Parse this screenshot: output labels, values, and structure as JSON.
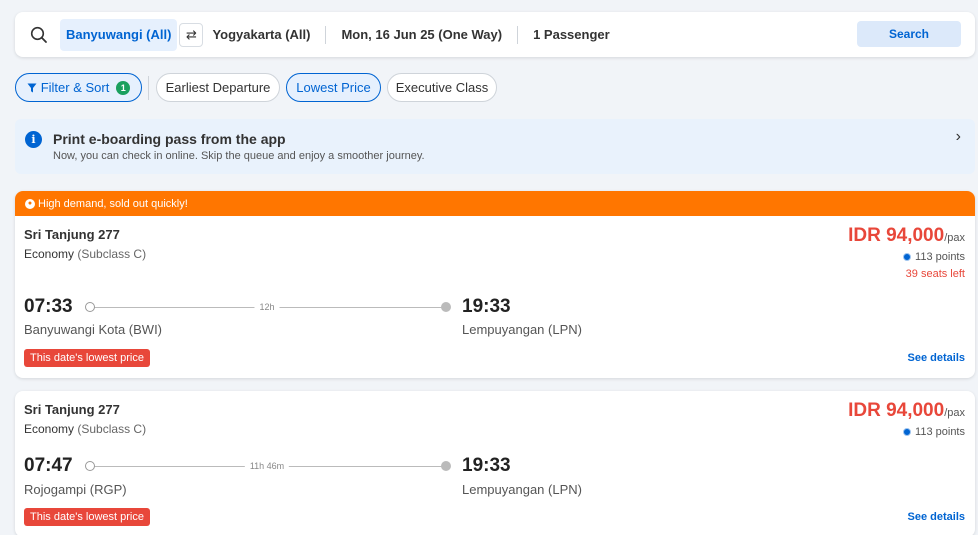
{
  "search": {
    "origin": "Banyuwangi (All)",
    "destination": "Yogyakarta (All)",
    "date": "Mon, 16 Jun 25 (One Way)",
    "passengers": "1 Passenger",
    "button": "Search"
  },
  "filters": {
    "filter_sort": "Filter & Sort",
    "filter_count": "1",
    "chips": [
      "Earliest Departure",
      "Lowest Price",
      "Executive Class"
    ],
    "active_chip": "Lowest Price"
  },
  "banner": {
    "title": "Print e-boarding pass from the app",
    "subtitle": "Now, you can check in online. Skip the queue and enjoy a smoother journey.",
    "info_icon": "i",
    "chevron": "›"
  },
  "results": [
    {
      "demand": "High demand, sold out quickly!",
      "name": "Sri Tanjung 277",
      "class": "Economy",
      "subclass": "(Subclass C)",
      "price": "IDR 94,000",
      "per": "/pax",
      "points": "113 points",
      "seats": "39 seats left",
      "dep_time": "07:33",
      "dep_station": "Banyuwangi Kota (BWI)",
      "duration": "12h",
      "arr_time": "19:33",
      "arr_station": "Lempuyangan (LPN)",
      "badge": "This date's lowest price",
      "details": "See details"
    },
    {
      "name": "Sri Tanjung 277",
      "class": "Economy",
      "subclass": "(Subclass C)",
      "price": "IDR 94,000",
      "per": "/pax",
      "points": "113 points",
      "dep_time": "07:47",
      "dep_station": "Rojogampi (RGP)",
      "duration": "11h 46m",
      "arr_time": "19:33",
      "arr_station": "Lempuyangan (LPN)",
      "badge": "This date's lowest price",
      "details": "See details"
    }
  ],
  "colors": {
    "accent": "#0064d2",
    "price": "#e8473a",
    "demand": "#ff7600",
    "filter_badge": "#1ba05e"
  }
}
